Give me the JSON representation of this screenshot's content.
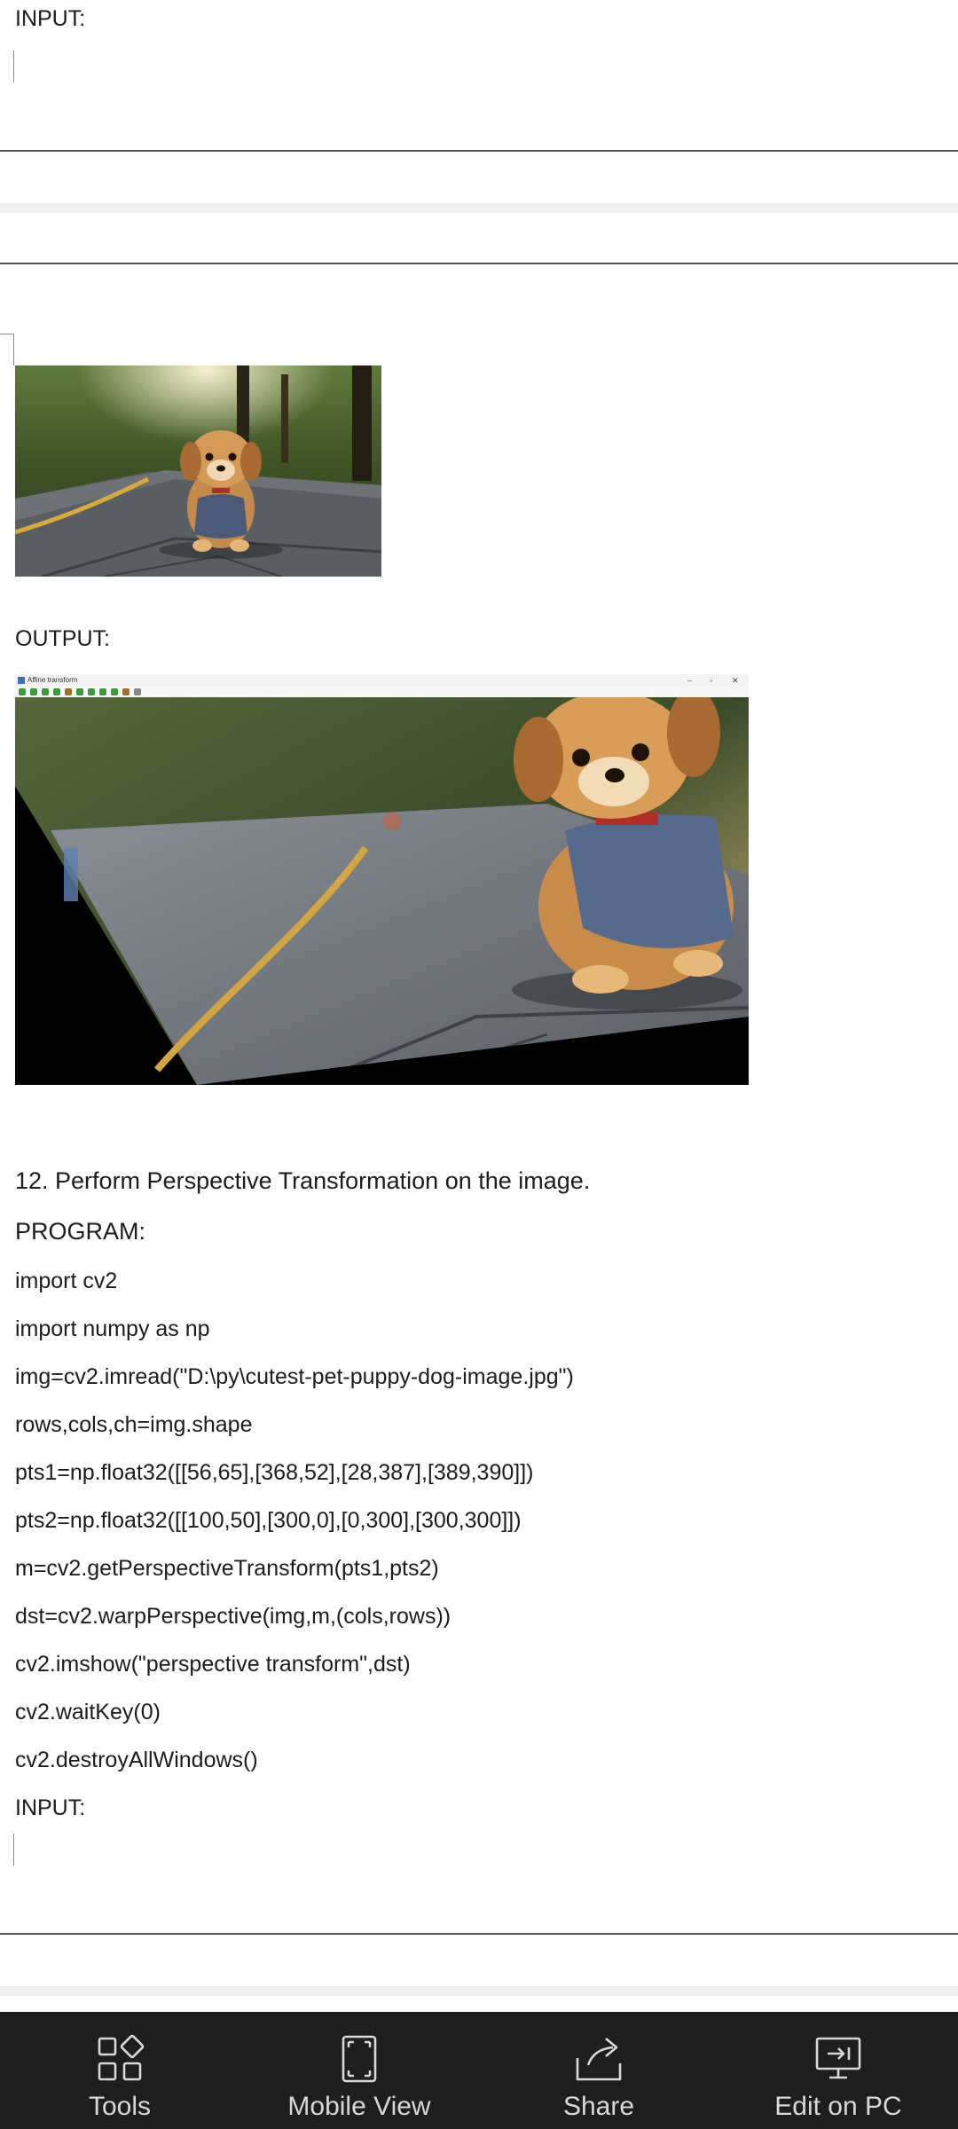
{
  "document": {
    "top_label": "INPUT:",
    "output_label": "OUTPUT:",
    "output_window_title": "Affine transform",
    "section_heading": "12. Perform Perspective Transformation on the image.",
    "program_label": "PROGRAM:",
    "code_lines": [
      "import cv2",
      "import numpy as np",
      "img=cv2.imread(\"D:\\py\\cutest-pet-puppy-dog-image.jpg\")",
      "rows,cols,ch=img.shape",
      "pts1=np.float32([[56,65],[368,52],[28,387],[389,390]])",
      "pts2=np.float32([[100,50],[300,0],[0,300],[300,300]])",
      "m=cv2.getPerspectiveTransform(pts1,pts2)",
      "dst=cv2.warpPerspective(img,m,(cols,rows))",
      "cv2.imshow(\"perspective transform\",dst)",
      "cv2.waitKey(0)",
      "cv2.destroyAllWindows()"
    ],
    "bottom_label": "INPUT:"
  },
  "bottom_bar": {
    "items": [
      {
        "label": "Tools",
        "icon": "tools-icon"
      },
      {
        "label": "Mobile View",
        "icon": "mobile-view-icon"
      },
      {
        "label": "Share",
        "icon": "share-icon"
      },
      {
        "label": "Edit on PC",
        "icon": "edit-on-pc-icon"
      }
    ],
    "background": "#1e1e1e",
    "text_color": "#d8d8d8"
  }
}
